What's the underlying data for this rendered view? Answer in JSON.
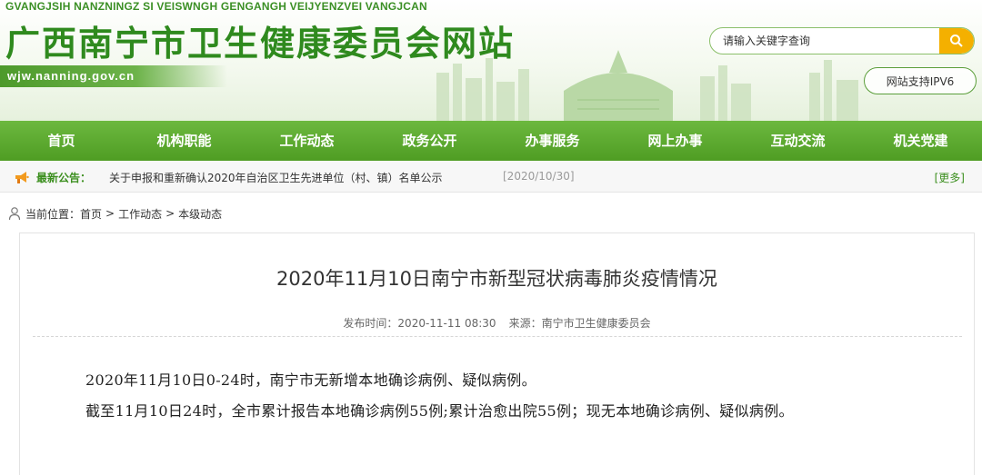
{
  "header": {
    "site_name_en": "GVANGJSIH NANZNINGZ SI VEISWNGH GENGANGH VEIJYENZVEI VANGJCAN",
    "site_name_cn": "广西南宁市卫生健康委员会网站",
    "domain": "wjw.nanning.gov.cn",
    "search_placeholder": "请输入关键字查询",
    "search_icon": "magnifier-icon",
    "ipv6_label": "网站支持IPV6"
  },
  "nav": {
    "items": [
      {
        "label": "首页"
      },
      {
        "label": "机构职能"
      },
      {
        "label": "工作动态"
      },
      {
        "label": "政务公开"
      },
      {
        "label": "办事服务"
      },
      {
        "label": "网上办事"
      },
      {
        "label": "互动交流"
      },
      {
        "label": "机关党建"
      }
    ]
  },
  "notice": {
    "icon": "megaphone-icon",
    "label": "最新公告：",
    "text": "关于申报和重新确认2020年自治区卫生先进单位（村、镇）名单公示",
    "date": "[2020/10/30]",
    "more": "[更多]"
  },
  "breadcrumb": {
    "icon": "person-icon",
    "prefix": "当前位置：",
    "items": [
      "首页",
      "工作动态",
      "本级动态"
    ],
    "separator": ">"
  },
  "article": {
    "title": "2020年11月10日南宁市新型冠状病毒肺炎疫情情况",
    "publish_time": "发布时间：2020-11-11 08:30",
    "source": "来源：南宁市卫生健康委员会",
    "paragraphs": [
      "2020年11月10日0-24时，南宁市无新增本地确诊病例、疑似病例。",
      "截至11月10日24时，全市累计报告本地确诊病例55例;累计治愈出院55例；现无本地确诊病例、疑似病例。"
    ]
  },
  "colors": {
    "brand_green": "#2f8a1e",
    "nav_green": "#5aa82e",
    "search_button": "#f4b000"
  }
}
